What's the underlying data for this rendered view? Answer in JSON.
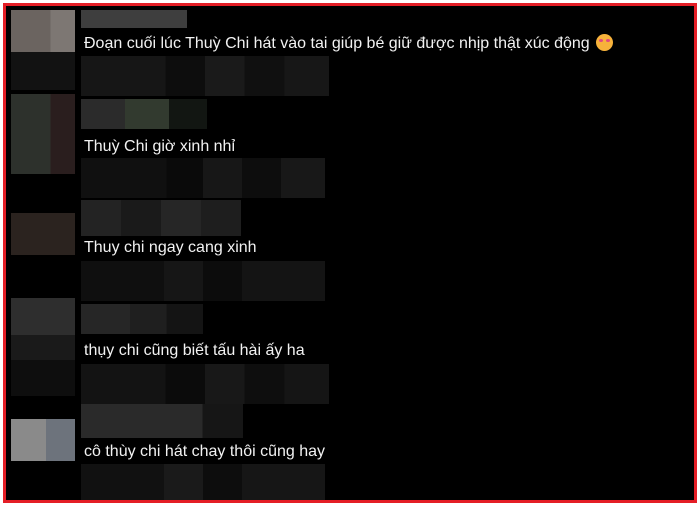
{
  "comments": [
    {
      "text": "Đoạn cuối lúc Thuỳ Chi hát vào tai giúp bé giữ được nhịp thật xúc động",
      "emoji": "smiling-face-with-hearts-icon"
    },
    {
      "text": "Thuỳ Chi giờ xinh nhỉ"
    },
    {
      "text": "Thuy chi ngay cang xinh"
    },
    {
      "text": "thụy chi cũng biết tấu hài ấy ha"
    },
    {
      "text": "cô thùy chi hát chay thôi cũng hay"
    }
  ],
  "colors": {
    "border": "#e41e26",
    "background": "#000000",
    "text": "#f2f2f2"
  }
}
